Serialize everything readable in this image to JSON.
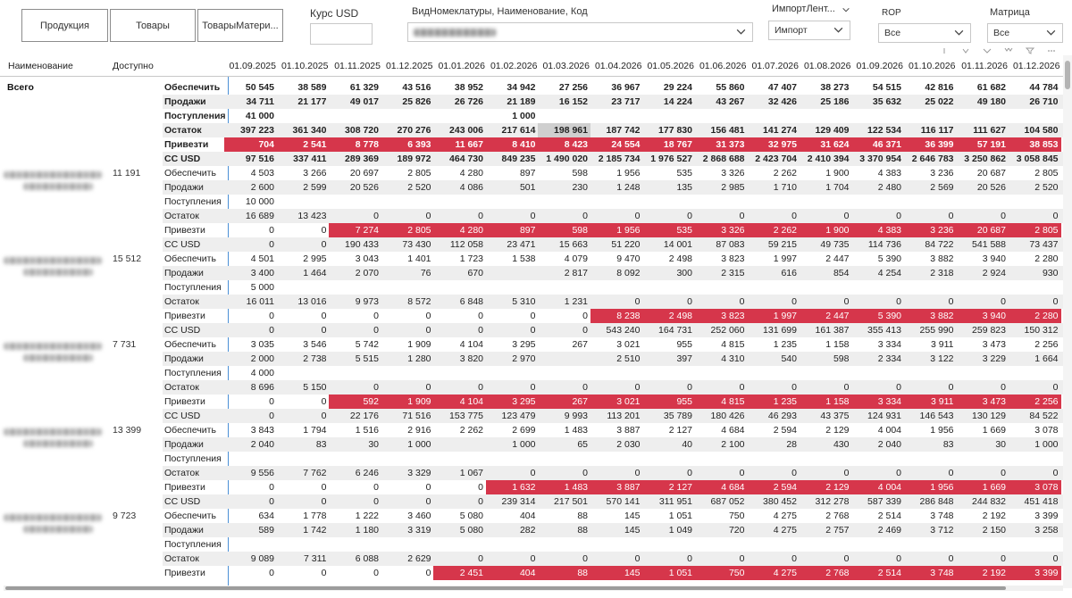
{
  "toolbar": {
    "buttons": [
      "Продукция",
      "Товары",
      "ТоварыМатери..."
    ]
  },
  "filters": {
    "usd": {
      "label": "Курс USD",
      "value": ""
    },
    "nomenclature": {
      "label": "ВидНомеклатуры, Наименование, Код"
    },
    "import": {
      "label": "ИмпортЛент...",
      "value": "Импорт"
    },
    "rop": {
      "label": "ROP",
      "value": "Все"
    },
    "matrix": {
      "label": "Матрица",
      "value": "Все"
    }
  },
  "header": {
    "name": "Наименование",
    "available": "Доступно",
    "dates": [
      "01.09.2025",
      "01.10.2025",
      "01.11.2025",
      "01.12.2025",
      "01.01.2026",
      "01.02.2026",
      "01.03.2026",
      "01.04.2026",
      "01.05.2026",
      "01.06.2026",
      "01.07.2026",
      "01.08.2026",
      "01.09.2026",
      "01.10.2026",
      "01.11.2026",
      "01.12.2026"
    ]
  },
  "total": {
    "label": "Всего",
    "rows": [
      {
        "label": "Обеспечить",
        "values": [
          "50 545",
          "38 589",
          "61 329",
          "43 516",
          "38 952",
          "34 942",
          "27 256",
          "36 967",
          "29 224",
          "55 860",
          "47 407",
          "38 273",
          "54 515",
          "42 816",
          "61 682",
          "44 784"
        ]
      },
      {
        "label": "Продажи",
        "values": [
          "34 711",
          "21 177",
          "49 017",
          "25 826",
          "26 726",
          "21 189",
          "16 152",
          "23 717",
          "14 224",
          "43 267",
          "32 426",
          "25 186",
          "35 632",
          "25 022",
          "49 180",
          "26 710"
        ]
      },
      {
        "label": "Поступления",
        "values": [
          "41 000",
          "",
          "",
          "",
          "",
          "1 000",
          "",
          "",
          "",
          "",
          "",
          "",
          "",
          "",
          "",
          ""
        ]
      },
      {
        "label": "Остаток",
        "values": [
          "397 223",
          "361 340",
          "308 720",
          "270 276",
          "243 006",
          "217 614",
          "198 961",
          "187 742",
          "177 830",
          "156 481",
          "141 274",
          "129 409",
          "122 534",
          "116 117",
          "111 627",
          "104 580"
        ],
        "grey": [
          6
        ]
      },
      {
        "label": "Привезти",
        "values": [
          "704",
          "2 541",
          "8 778",
          "6 393",
          "11 667",
          "8 410",
          "8 423",
          "24 554",
          "18 767",
          "31 373",
          "32 975",
          "31 624",
          "46 371",
          "36 399",
          "57 191",
          "38 853"
        ],
        "red": [
          0,
          1,
          2,
          3,
          4,
          5,
          6,
          7,
          8,
          9,
          10,
          11,
          12,
          13,
          14,
          15
        ]
      },
      {
        "label": "СС USD",
        "values": [
          "97 516",
          "337 411",
          "289 369",
          "189 972",
          "464 730",
          "849 235",
          "1 490 020",
          "2 185 734",
          "1 976 527",
          "2 868 688",
          "2 423 704",
          "2 410 394",
          "3 370 954",
          "2 646 783",
          "3 250 862",
          "3 058 845"
        ]
      }
    ]
  },
  "groups": [
    {
      "available": "11 191",
      "rows": [
        {
          "label": "Обеспечить",
          "values": [
            "4 503",
            "3 266",
            "20 697",
            "2 805",
            "4 280",
            "897",
            "598",
            "1 956",
            "535",
            "3 326",
            "2 262",
            "1 900",
            "4 383",
            "3 236",
            "20 687",
            "2 805"
          ]
        },
        {
          "label": "Продажи",
          "values": [
            "2 600",
            "2 599",
            "20 526",
            "2 520",
            "4 086",
            "501",
            "230",
            "1 248",
            "135",
            "2 985",
            "1 710",
            "1 704",
            "2 480",
            "2 569",
            "20 526",
            "2 520"
          ]
        },
        {
          "label": "Поступления",
          "values": [
            "10 000",
            "",
            "",
            "",
            "",
            "",
            "",
            "",
            "",
            "",
            "",
            "",
            "",
            "",
            "",
            ""
          ]
        },
        {
          "label": "Остаток",
          "values": [
            "16 689",
            "13 423",
            "0",
            "0",
            "0",
            "0",
            "0",
            "0",
            "0",
            "0",
            "0",
            "0",
            "0",
            "0",
            "0",
            "0"
          ]
        },
        {
          "label": "Привезти",
          "values": [
            "0",
            "0",
            "7 274",
            "2 805",
            "4 280",
            "897",
            "598",
            "1 956",
            "535",
            "3 326",
            "2 262",
            "1 900",
            "4 383",
            "3 236",
            "20 687",
            "2 805"
          ],
          "red": [
            2,
            3,
            4,
            5,
            6,
            7,
            8,
            9,
            10,
            11,
            12,
            13,
            14,
            15
          ]
        },
        {
          "label": "СС USD",
          "values": [
            "0",
            "0",
            "190 433",
            "73 430",
            "112 058",
            "23 471",
            "15 663",
            "51 220",
            "14 001",
            "87 083",
            "59 215",
            "49 735",
            "114 736",
            "84 722",
            "541 588",
            "73 437"
          ]
        }
      ]
    },
    {
      "available": "15 512",
      "rows": [
        {
          "label": "Обеспечить",
          "values": [
            "4 501",
            "2 995",
            "3 043",
            "1 401",
            "1 723",
            "1 538",
            "4 079",
            "9 470",
            "2 498",
            "3 823",
            "1 997",
            "2 447",
            "5 390",
            "3 882",
            "3 940",
            "2 280"
          ]
        },
        {
          "label": "Продажи",
          "values": [
            "3 400",
            "1 464",
            "2 070",
            "76",
            "670",
            "",
            "2 817",
            "8 092",
            "300",
            "2 315",
            "616",
            "854",
            "4 254",
            "2 318",
            "2 924",
            "930"
          ]
        },
        {
          "label": "Поступления",
          "values": [
            "5 000",
            "",
            "",
            "",
            "",
            "",
            "",
            "",
            "",
            "",
            "",
            "",
            "",
            "",
            "",
            ""
          ]
        },
        {
          "label": "Остаток",
          "values": [
            "16 011",
            "13 016",
            "9 973",
            "8 572",
            "6 848",
            "5 310",
            "1 231",
            "0",
            "0",
            "0",
            "0",
            "0",
            "0",
            "0",
            "0",
            "0"
          ]
        },
        {
          "label": "Привезти",
          "values": [
            "0",
            "0",
            "0",
            "0",
            "0",
            "0",
            "0",
            "8 238",
            "2 498",
            "3 823",
            "1 997",
            "2 447",
            "5 390",
            "3 882",
            "3 940",
            "2 280"
          ],
          "red": [
            7,
            8,
            9,
            10,
            11,
            12,
            13,
            14,
            15
          ]
        },
        {
          "label": "СС USD",
          "values": [
            "0",
            "0",
            "0",
            "0",
            "0",
            "0",
            "0",
            "543 240",
            "164 731",
            "252 060",
            "131 699",
            "161 387",
            "355 413",
            "255 990",
            "259 823",
            "150 312"
          ]
        }
      ]
    },
    {
      "available": "7 731",
      "rows": [
        {
          "label": "Обеспечить",
          "values": [
            "3 035",
            "3 546",
            "5 742",
            "1 909",
            "4 104",
            "3 295",
            "267",
            "3 021",
            "955",
            "4 815",
            "1 235",
            "1 158",
            "3 334",
            "3 911",
            "3 473",
            "2 256"
          ]
        },
        {
          "label": "Продажи",
          "values": [
            "2 000",
            "2 738",
            "5 515",
            "1 280",
            "3 820",
            "2 970",
            "",
            "2 510",
            "397",
            "4 310",
            "540",
            "598",
            "2 334",
            "3 122",
            "3 229",
            "1 664"
          ]
        },
        {
          "label": "Поступления",
          "values": [
            "4 000",
            "",
            "",
            "",
            "",
            "",
            "",
            "",
            "",
            "",
            "",
            "",
            "",
            "",
            "",
            ""
          ]
        },
        {
          "label": "Остаток",
          "values": [
            "8 696",
            "5 150",
            "0",
            "0",
            "0",
            "0",
            "0",
            "0",
            "0",
            "0",
            "0",
            "0",
            "0",
            "0",
            "0",
            "0"
          ]
        },
        {
          "label": "Привезти",
          "values": [
            "0",
            "0",
            "592",
            "1 909",
            "4 104",
            "3 295",
            "267",
            "3 021",
            "955",
            "4 815",
            "1 235",
            "1 158",
            "3 334",
            "3 911",
            "3 473",
            "2 256"
          ],
          "red": [
            2,
            3,
            4,
            5,
            6,
            7,
            8,
            9,
            10,
            11,
            12,
            13,
            14,
            15
          ]
        },
        {
          "label": "СС USD",
          "values": [
            "0",
            "0",
            "22 176",
            "71 516",
            "153 775",
            "123 479",
            "9 993",
            "113 201",
            "35 789",
            "180 426",
            "46 293",
            "43 375",
            "124 931",
            "146 543",
            "130 129",
            "84 522"
          ]
        }
      ]
    },
    {
      "available": "13 399",
      "rows": [
        {
          "label": "Обеспечить",
          "values": [
            "3 843",
            "1 794",
            "1 516",
            "2 916",
            "2 262",
            "2 699",
            "1 483",
            "3 887",
            "2 127",
            "4 684",
            "2 594",
            "2 129",
            "4 004",
            "1 956",
            "1 669",
            "3 078"
          ]
        },
        {
          "label": "Продажи",
          "values": [
            "2 040",
            "83",
            "30",
            "1 000",
            "",
            "1 000",
            "65",
            "2 030",
            "40",
            "2 100",
            "28",
            "430",
            "2 040",
            "83",
            "30",
            "1 000"
          ]
        },
        {
          "label": "Поступления",
          "values": [
            "",
            "",
            "",
            "",
            "",
            "",
            "",
            "",
            "",
            "",
            "",
            "",
            "",
            "",
            "",
            ""
          ]
        },
        {
          "label": "Остаток",
          "values": [
            "9 556",
            "7 762",
            "6 246",
            "3 329",
            "1 067",
            "0",
            "0",
            "0",
            "0",
            "0",
            "0",
            "0",
            "0",
            "0",
            "0",
            "0"
          ]
        },
        {
          "label": "Привезти",
          "values": [
            "0",
            "0",
            "0",
            "0",
            "0",
            "1 632",
            "1 483",
            "3 887",
            "2 127",
            "4 684",
            "2 594",
            "2 129",
            "4 004",
            "1 956",
            "1 669",
            "3 078"
          ],
          "red": [
            5,
            6,
            7,
            8,
            9,
            10,
            11,
            12,
            13,
            14,
            15
          ]
        },
        {
          "label": "СС USD",
          "values": [
            "0",
            "0",
            "0",
            "0",
            "0",
            "239 314",
            "217 501",
            "570 141",
            "311 951",
            "687 052",
            "380 452",
            "312 278",
            "587 339",
            "286 848",
            "244 832",
            "451 418"
          ]
        }
      ]
    },
    {
      "available": "9 723",
      "rows": [
        {
          "label": "Обеспечить",
          "values": [
            "634",
            "1 778",
            "1 222",
            "3 460",
            "5 080",
            "404",
            "88",
            "145",
            "1 051",
            "750",
            "4 275",
            "2 768",
            "2 514",
            "3 748",
            "2 192",
            "3 399"
          ]
        },
        {
          "label": "Продажи",
          "values": [
            "589",
            "1 742",
            "1 180",
            "3 319",
            "5 080",
            "282",
            "88",
            "145",
            "1 049",
            "720",
            "4 275",
            "2 757",
            "2 469",
            "3 712",
            "2 150",
            "3 258"
          ]
        },
        {
          "label": "Поступления",
          "values": [
            "",
            "",
            "",
            "",
            "",
            "",
            "",
            "",
            "",
            "",
            "",
            "",
            "",
            "",
            "",
            ""
          ]
        },
        {
          "label": "Остаток",
          "values": [
            "9 089",
            "7 311",
            "6 088",
            "2 629",
            "0",
            "0",
            "0",
            "0",
            "0",
            "0",
            "0",
            "0",
            "0",
            "0",
            "0",
            "0"
          ]
        },
        {
          "label": "Привезти",
          "values": [
            "0",
            "0",
            "0",
            "0",
            "2 451",
            "404",
            "88",
            "145",
            "1 051",
            "750",
            "4 275",
            "2 768",
            "2 514",
            "3 748",
            "2 192",
            "3 399"
          ],
          "red": [
            4,
            5,
            6,
            7,
            8,
            9,
            10,
            11,
            12,
            13,
            14,
            15
          ]
        }
      ]
    }
  ],
  "colors": {
    "highlight_red": "#d6364b",
    "divider_blue": "#4a8fd6",
    "row_shade": "#eeeeee"
  }
}
